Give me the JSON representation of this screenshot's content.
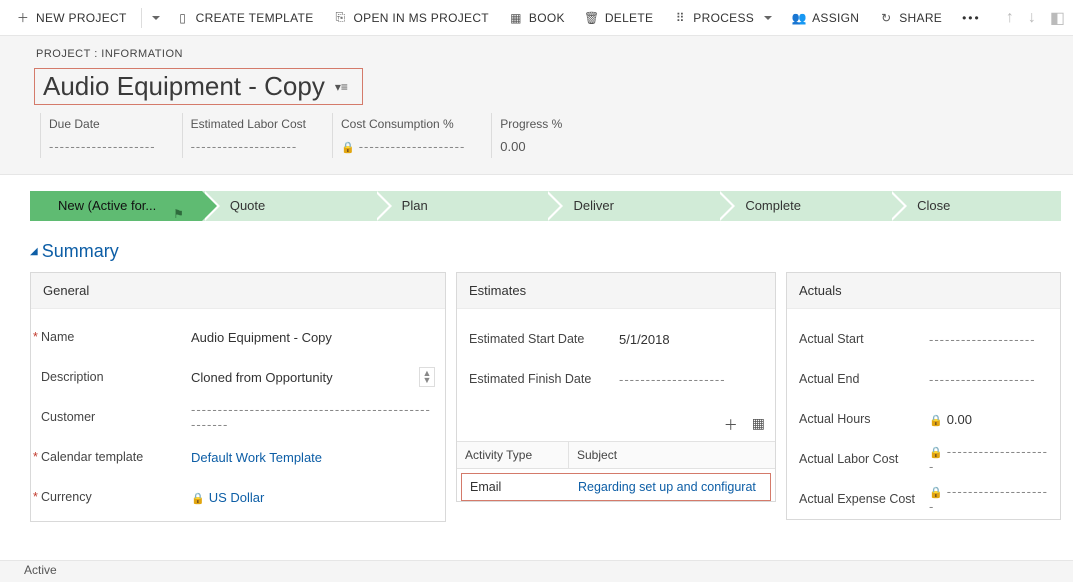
{
  "toolbar": {
    "new_project": "NEW PROJECT",
    "create_template": "CREATE TEMPLATE",
    "open_ms_project": "OPEN IN MS PROJECT",
    "book": "BOOK",
    "delete": "DELETE",
    "process": "PROCESS",
    "assign": "ASSIGN",
    "share": "SHARE"
  },
  "header": {
    "breadcrumb": "PROJECT : INFORMATION",
    "title": "Audio Equipment - Copy",
    "stats": {
      "due_date_label": "Due Date",
      "due_date_value": "--------------------",
      "labor_label": "Estimated Labor Cost",
      "labor_value": "--------------------",
      "cost_label": "Cost Consumption %",
      "cost_value": "--------------------",
      "progress_label": "Progress %",
      "progress_value": "0.00"
    }
  },
  "stages": {
    "s1": "New (Active for...",
    "s2": "Quote",
    "s3": "Plan",
    "s4": "Deliver",
    "s5": "Complete",
    "s6": "Close"
  },
  "section_summary": "Summary",
  "general": {
    "title": "General",
    "name_label": "Name",
    "name_value": "Audio Equipment - Copy",
    "desc_label": "Description",
    "desc_value": "Cloned from Opportunity",
    "customer_label": "Customer",
    "customer_value": "----------------------------------------------------",
    "calendar_label": "Calendar template",
    "calendar_value": "Default Work Template",
    "currency_label": "Currency",
    "currency_value": "US Dollar"
  },
  "estimates": {
    "title": "Estimates",
    "start_label": "Estimated Start Date",
    "start_value": "5/1/2018",
    "finish_label": "Estimated Finish Date",
    "finish_value": "--------------------",
    "col_activity": "Activity Type",
    "col_subject": "Subject",
    "row_activity": "Email",
    "row_subject": "Regarding set up and configurat"
  },
  "actuals": {
    "title": "Actuals",
    "start_label": "Actual Start",
    "start_value": "--------------------",
    "end_label": "Actual End",
    "end_value": "--------------------",
    "hours_label": "Actual Hours",
    "hours_value": "0.00",
    "labor_label": "Actual Labor Cost",
    "labor_value": "--------------------",
    "expense_label": "Actual Expense Cost",
    "expense_value": "--------------------"
  },
  "statusbar": "Active"
}
